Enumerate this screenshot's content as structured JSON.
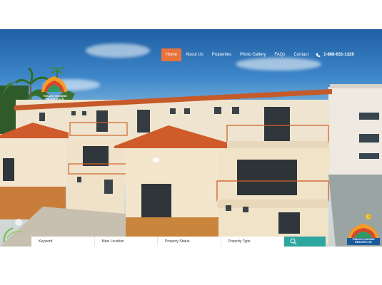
{
  "brand": {
    "logo_text_line1": "TOBAGO HOUSING",
    "logo_text_line2": "RESORTS LTD",
    "colors": {
      "accent": "#e8733a",
      "teal": "#2ea6a0",
      "logo_orange": "#f29b2a",
      "logo_red": "#d9452b",
      "logo_green": "#2f9a63"
    }
  },
  "nav": {
    "items": [
      {
        "label": "Home",
        "active": true
      },
      {
        "label": "About Us",
        "active": false
      },
      {
        "label": "Properties",
        "active": false
      },
      {
        "label": "Photo Gallery",
        "active": false
      },
      {
        "label": "FAQs",
        "active": false
      },
      {
        "label": "Contact",
        "active": false
      }
    ],
    "phone": "1-868-631-1320",
    "phone_icon": "phone-icon"
  },
  "search": {
    "fields": [
      {
        "label": "Keyword"
      },
      {
        "label": "Main Location"
      },
      {
        "label": "Property Status"
      },
      {
        "label": "Property Type"
      }
    ],
    "button_icon": "search-icon"
  },
  "corner_logo": {
    "line1": "TOBAGO HOUSING",
    "line2": "RESORTS LTD"
  }
}
